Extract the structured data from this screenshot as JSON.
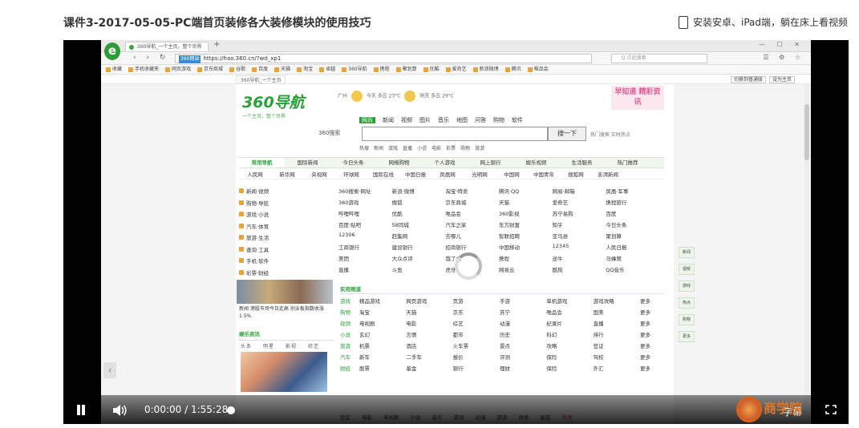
{
  "header": {
    "course_title": "课件3-2017-05-05-PC端首页装修各大装修模块的使用技巧",
    "install_hint": "安装安卓、iPad端，躺在床上看视频"
  },
  "browser": {
    "logo_letter": "e",
    "tab_label": "360导航_一个主页，整个世界",
    "url_badge": "360网站",
    "url": "https://hao.360.cn/?wd_xp1",
    "search_placeholder": "Q 点此搜索",
    "bookmarks": [
      "收藏",
      "手机收藏夹",
      "网页游戏",
      "京东商城",
      "谷歌",
      "百度",
      "天猫",
      "淘宝",
      "卓越",
      "360导航",
      "携程",
      "聚划算",
      "优酷",
      "爱奇艺",
      "新浪微博",
      "腾讯",
      "唯品会"
    ],
    "notice_left": "360导航_一个主页",
    "notice_right": [
      "切换到普通版",
      "设为主页"
    ]
  },
  "page360": {
    "logo": "360导航",
    "logo_sub": "一个主页，整个世界",
    "weather_city": "广州",
    "weather_today": "今天 多云 23°C",
    "weather_tomorrow": "明天 多云 29°C",
    "banner": "早知道 精彩资讯",
    "search_tabs": [
      "网页",
      "新闻",
      "视频",
      "图片",
      "音乐",
      "地图",
      "问答",
      "购物",
      "软件"
    ],
    "search_brand": "360搜索",
    "search_button": "搜一下",
    "search_side": "热门搜索 实时热点",
    "hot_words": [
      "热搜",
      "新闻",
      "游戏",
      "直播",
      "小说",
      "电影",
      "彩票",
      "购物",
      "旅游"
    ],
    "cat_tabs": [
      "常用导航",
      "国际新闻",
      "今日头条",
      "网络购物",
      "个人游戏",
      "网上银行",
      "娱乐视频",
      "生活服务",
      "热门推荐"
    ],
    "sub_links": [
      "人民网",
      "新华网",
      "央视网",
      "环球网",
      "国际在线",
      "中国日报",
      "凤凰网",
      "光明网",
      "中国网",
      "中国青年",
      "搜狐网",
      "澎湃新闻"
    ],
    "left_items": [
      "新闻·视频",
      "购物·导航",
      "游戏·小说",
      "汽车·体育",
      "旅游·生活",
      "查询·工具",
      "手机·软件",
      "彩票·财经"
    ],
    "site_rows": [
      [
        "360搜索·网址",
        "新浪·微博",
        "淘宝·特卖",
        "腾讯·QQ",
        "网易·邮箱",
        "凤凰·军事"
      ],
      [
        "360游戏",
        "搜狐",
        "京东商城",
        "天猫",
        "爱奇艺",
        "携程旅行"
      ],
      [
        "哔哩哔哩",
        "优酷",
        "唯品会",
        "360影视",
        "苏宁易购",
        "百度"
      ],
      [
        "百度·贴吧",
        "58同城",
        "汽车之家",
        "东方财富",
        "知乎",
        "今日头条"
      ],
      [
        "12306",
        "赶集网",
        "去哪儿",
        "智联招聘",
        "亚马逊",
        "聚划算"
      ],
      [
        "工商银行",
        "建设银行",
        "招商银行",
        "中国移动",
        "12345",
        "人民日报"
      ],
      [
        "美团",
        "大众点评",
        "饿了么",
        "携程",
        "途牛",
        "马蜂窝"
      ],
      [
        "直播",
        "斗鱼",
        "虎牙",
        "网易云",
        "酷狗",
        "QQ音乐"
      ]
    ],
    "photo_caption": "新闻 港股市场今日走高 创业板指数收涨1.5%",
    "side_news_title": "娱乐资讯",
    "side_news_tabs": [
      "头条",
      "明星",
      "影视",
      "综艺"
    ],
    "panel_title": "实用频道",
    "panel_rows": [
      [
        "游戏",
        "精品游戏",
        "网页游戏",
        "页游",
        "手游",
        "单机游戏",
        "游戏攻略",
        "更多"
      ],
      [
        "购物",
        "淘宝",
        "天猫",
        "京东",
        "苏宁",
        "唯品会",
        "国美",
        "更多"
      ],
      [
        "视频",
        "电视剧",
        "电影",
        "综艺",
        "动漫",
        "纪录片",
        "直播",
        "更多"
      ],
      [
        "小说",
        "玄幻",
        "言情",
        "都市",
        "历史",
        "科幻",
        "排行",
        "更多"
      ],
      [
        "旅游",
        "机票",
        "酒店",
        "火车票",
        "景点",
        "攻略",
        "签证",
        "更多"
      ],
      [
        "汽车",
        "新车",
        "二手车",
        "报价",
        "评测",
        "保险",
        "驾校",
        "更多"
      ],
      [
        "财经",
        "股票",
        "基金",
        "银行",
        "理财",
        "保险",
        "外汇",
        "更多"
      ]
    ],
    "bottom_bar": [
      "社区",
      "电影",
      "电视剧",
      "小说",
      "音乐",
      "游戏",
      "动漫",
      "旅游",
      "体育",
      "星座",
      "美食"
    ],
    "right_icons": [
      "新闻",
      "视频",
      "游戏",
      "热点",
      "购物",
      "更多"
    ]
  },
  "player": {
    "current_time": "0:00:00",
    "separator": "/",
    "duration": "1:55:28",
    "subtitle_label": "字幕",
    "watermark": "商学院",
    "progress": 0.0
  }
}
